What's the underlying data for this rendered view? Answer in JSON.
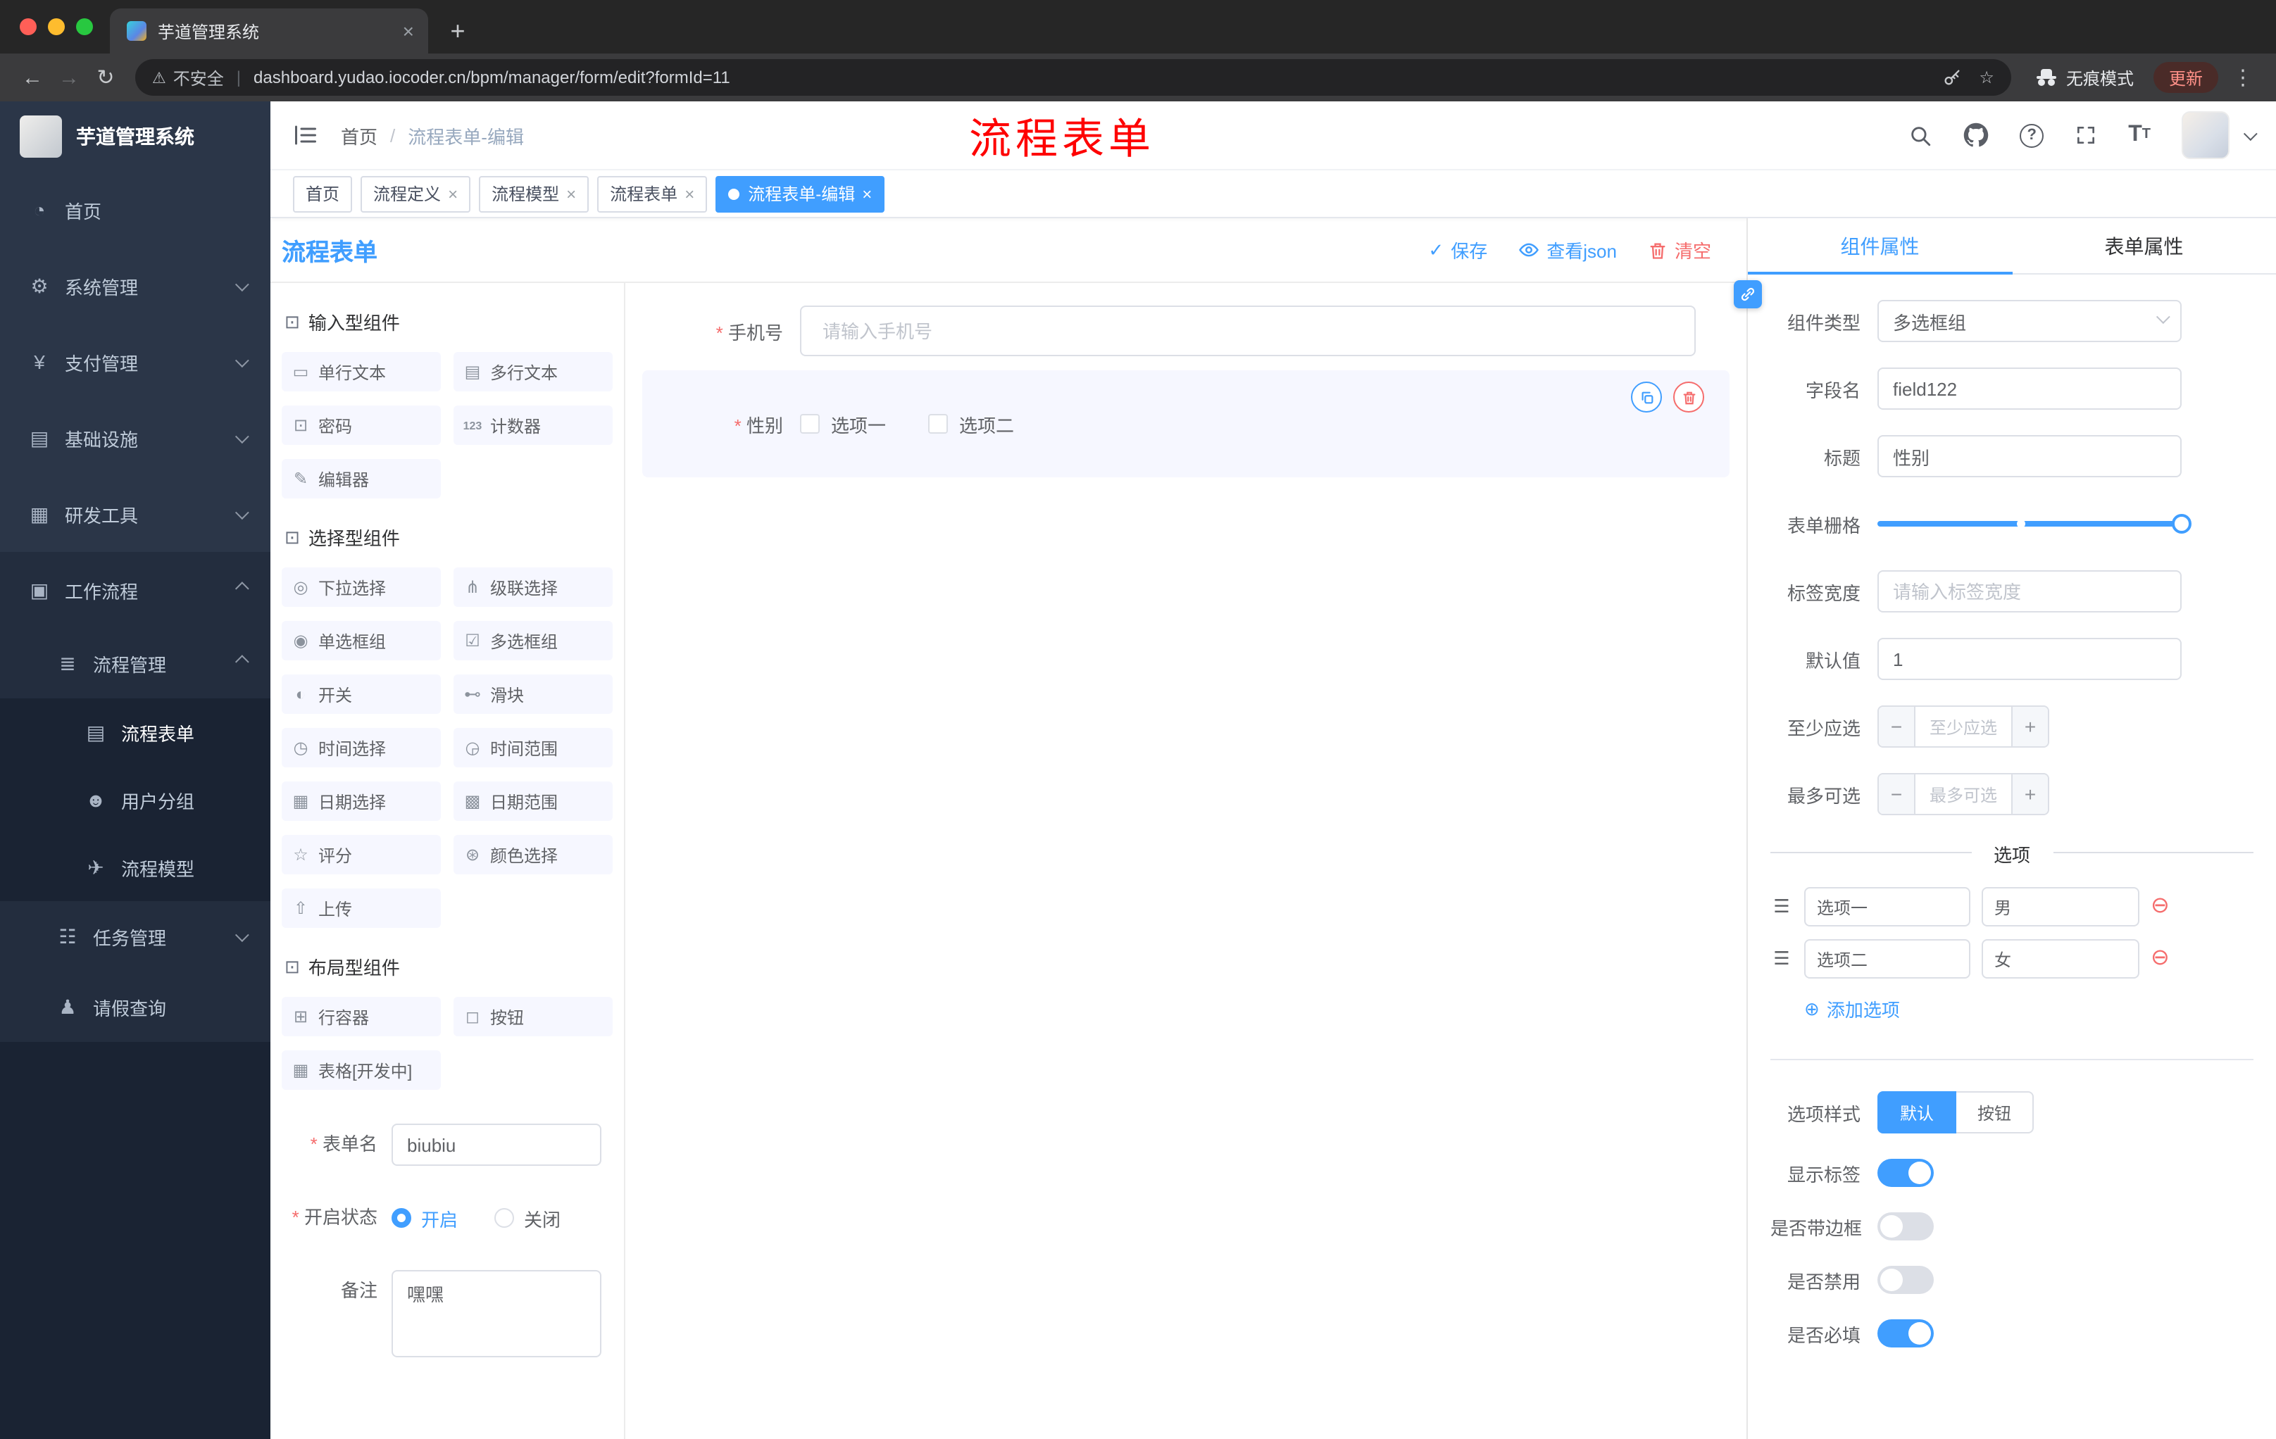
{
  "browser": {
    "tab_title": "芋道管理系统",
    "security_label": "不安全",
    "url": "dashboard.yudao.iocoder.cn/bpm/manager/form/edit?formId=11",
    "incognito_label": "无痕模式",
    "update_label": "更新"
  },
  "icons": {
    "back": "←",
    "forward": "→",
    "reload": "↻",
    "star": "☆",
    "more": "⋮",
    "warning": "⚠",
    "close": "×",
    "plus": "+",
    "help": "?",
    "check": "✓",
    "add": "⊕",
    "remove": "⊖",
    "drag": "☰",
    "cube": "⊡",
    "dashboard": "◔",
    "gear": "⚙",
    "yen": "¥",
    "infra": "▤",
    "tool": "▦",
    "workflow": "▣",
    "list": "≣",
    "doc": "▤",
    "users": "☻",
    "send": "✈",
    "tasks": "☷",
    "person": "♟",
    "input": "▭",
    "textarea": "▤",
    "password": "⊡",
    "counter": "123",
    "editor": "✎",
    "select": "◎",
    "cascader": "⋔",
    "radio": "◉",
    "checkbox": "☑",
    "switch": "◐",
    "slider": "⊷",
    "time": "◷",
    "time_range": "◶",
    "date": "▦",
    "date_range": "▩",
    "rate": "☆",
    "color": "⊛",
    "upload": "⇧",
    "row": "⊞",
    "button": "◻",
    "table": "▦"
  },
  "sidebar": {
    "logo_title": "芋道管理系统",
    "items": [
      {
        "label": "首页"
      },
      {
        "label": "系统管理"
      },
      {
        "label": "支付管理"
      },
      {
        "label": "基础设施"
      },
      {
        "label": "研发工具"
      },
      {
        "label": "工作流程"
      },
      {
        "label": "流程管理"
      },
      {
        "label": "流程表单"
      },
      {
        "label": "用户分组"
      },
      {
        "label": "流程模型"
      },
      {
        "label": "任务管理"
      },
      {
        "label": "请假查询"
      }
    ]
  },
  "header": {
    "breadcrumb": [
      "首页",
      "流程表单-编辑"
    ],
    "annotation": "流程表单"
  },
  "tabs": [
    {
      "label": "首页"
    },
    {
      "label": "流程定义"
    },
    {
      "label": "流程模型"
    },
    {
      "label": "流程表单"
    },
    {
      "label": "流程表单-编辑"
    }
  ],
  "designer": {
    "title": "流程表单",
    "actions": {
      "save": "保存",
      "view_json": "查看json",
      "clear": "清空"
    },
    "palette": {
      "groups": [
        {
          "title": "输入型组件",
          "items": [
            "单行文本",
            "多行文本",
            "密码",
            "计数器",
            "编辑器"
          ]
        },
        {
          "title": "选择型组件",
          "items": [
            "下拉选择",
            "级联选择",
            "单选框组",
            "多选框组",
            "开关",
            "滑块",
            "时间选择",
            "时间范围",
            "日期选择",
            "日期范围",
            "评分",
            "颜色选择",
            "上传"
          ]
        },
        {
          "title": "布局型组件",
          "items": [
            "行容器",
            "按钮",
            "表格[开发中]"
          ]
        }
      ],
      "form": {
        "name_label": "表单名",
        "name_value": "biubiu",
        "status_label": "开启状态",
        "status_on": "开启",
        "status_off": "关闭",
        "remark_label": "备注",
        "remark_value": "嘿嘿"
      }
    },
    "canvas": {
      "phone_label": "手机号",
      "phone_placeholder": "请输入手机号",
      "gender_label": "性别",
      "gender_options": [
        "选项一",
        "选项二"
      ]
    },
    "props": {
      "tabs": [
        "组件属性",
        "表单属性"
      ],
      "component_type_label": "组件类型",
      "component_type_value": "多选框组",
      "field_name_label": "字段名",
      "field_name_value": "field122",
      "title_label": "标题",
      "title_value": "性别",
      "grid_label": "表单栅格",
      "label_width_label": "标签宽度",
      "label_width_placeholder": "请输入标签宽度",
      "default_label": "默认值",
      "default_value": "1",
      "min_label": "至少应选",
      "min_placeholder": "至少应选",
      "max_label": "最多可选",
      "max_placeholder": "最多可选",
      "options_title": "选项",
      "options": [
        {
          "label": "选项一",
          "value": "男"
        },
        {
          "label": "选项二",
          "value": "女"
        }
      ],
      "add_option": "添加选项",
      "style_label": "选项样式",
      "style_options": [
        "默认",
        "按钮"
      ],
      "style_active": "默认",
      "toggles": [
        {
          "label": "显示标签",
          "on": true
        },
        {
          "label": "是否带边框",
          "on": false
        },
        {
          "label": "是否禁用",
          "on": false
        },
        {
          "label": "是否必填",
          "on": true
        }
      ]
    }
  },
  "colors": {
    "accent": "#409eff",
    "danger": "#f56c6c",
    "annotation_red": "#fe0000",
    "sidebar_bg": "#1a2333",
    "active_tab_bg": "#409eff",
    "palette_item_bg": "#f6f7ff"
  }
}
